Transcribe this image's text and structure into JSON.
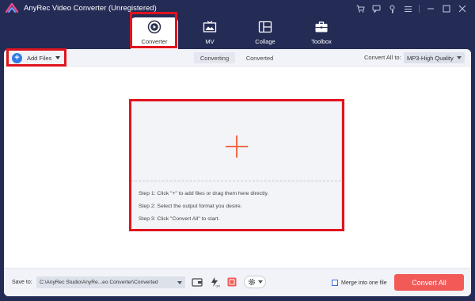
{
  "window": {
    "title": "AnyRec Video Converter (Unregistered)",
    "controls": [
      "cart-icon",
      "chat-icon",
      "key-icon",
      "menu-icon",
      "minimize-icon",
      "maximize-icon",
      "close-icon"
    ]
  },
  "nav": {
    "tabs": [
      {
        "label": "Converter",
        "icon": "converter-icon",
        "active": true,
        "highlighted": true
      },
      {
        "label": "MV",
        "icon": "mv-icon",
        "active": false
      },
      {
        "label": "Collage",
        "icon": "collage-icon",
        "active": false
      },
      {
        "label": "Toolbox",
        "icon": "toolbox-icon",
        "active": false
      }
    ]
  },
  "toolbar": {
    "add_files_label": "Add Files",
    "segments": [
      {
        "label": "Converting",
        "active": true
      },
      {
        "label": "Converted",
        "active": false
      }
    ],
    "convert_all_to_label": "Convert All to:",
    "format_value": "MP3-High Quality"
  },
  "dropzone": {
    "steps": [
      "Step 1: Click \"+\" to add files or drag them here directly.",
      "Step 2: Select the output format you desire.",
      "Step 3: Click \"Convert All\" to start."
    ]
  },
  "bottombar": {
    "save_to_label": "Save to:",
    "save_path": "C:\\AnyRec Studio\\AnyRe...eo Converter\\Converted",
    "merge_label": "Merge into one file",
    "merge_checked": false,
    "convert_all_label": "Convert All"
  },
  "colors": {
    "background": "#242b55",
    "accent_red": "#f25a58",
    "highlight": "#e0141e",
    "plus_accent": "#f06a4a",
    "add_blue": "#2f7ae5"
  }
}
